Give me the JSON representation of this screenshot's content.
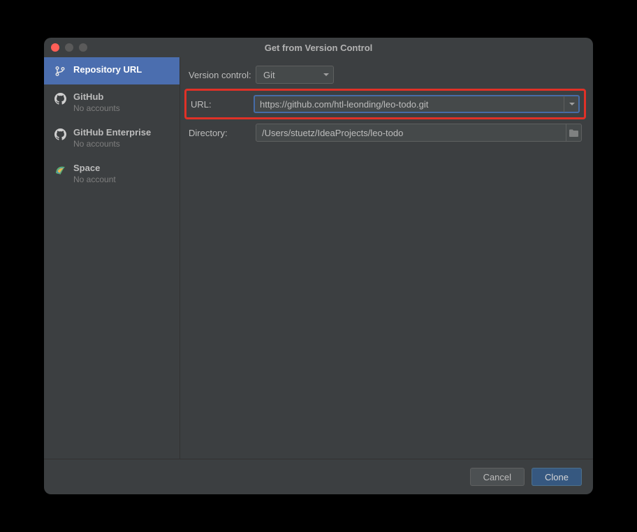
{
  "window": {
    "title": "Get from Version Control"
  },
  "sidebar": {
    "items": [
      {
        "label": "Repository URL",
        "sub": ""
      },
      {
        "label": "GitHub",
        "sub": "No accounts"
      },
      {
        "label": "GitHub Enterprise",
        "sub": "No accounts"
      },
      {
        "label": "Space",
        "sub": "No account"
      }
    ]
  },
  "form": {
    "vc_label": "Version control:",
    "vc_value": "Git",
    "url_label": "URL:",
    "url_value": "https://github.com/htl-leonding/leo-todo.git",
    "dir_label": "Directory:",
    "dir_value": "/Users/stuetz/IdeaProjects/leo-todo"
  },
  "footer": {
    "cancel": "Cancel",
    "clone": "Clone"
  }
}
